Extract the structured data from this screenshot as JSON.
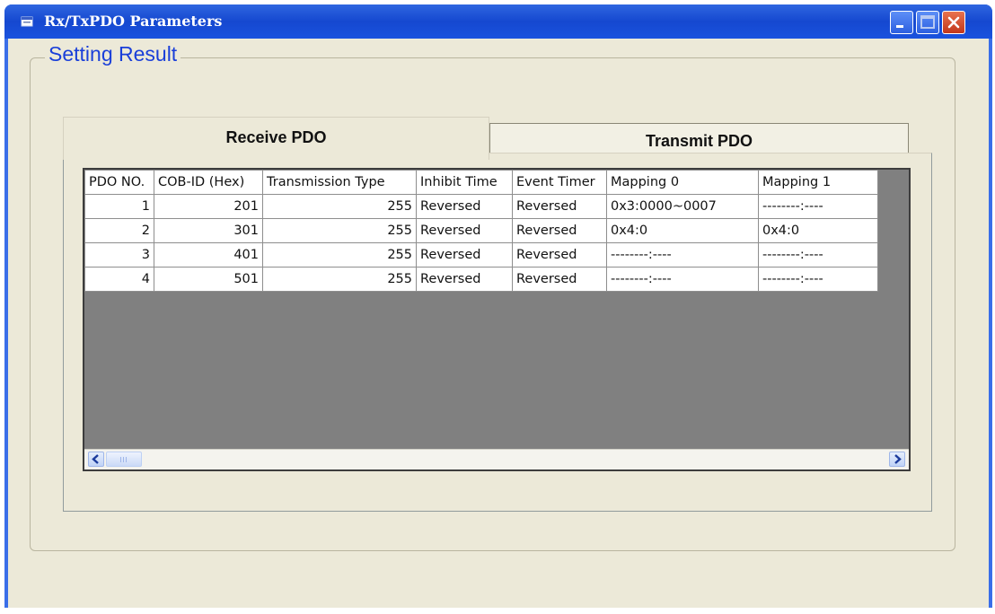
{
  "window": {
    "title": "Rx/TxPDO Parameters",
    "icons": {
      "app": "app-icon",
      "minimize": "minimize-icon",
      "maximize": "maximize-icon",
      "close": "close-icon"
    },
    "colors": {
      "titlebar": "#1548d0",
      "client": "#ece9d8",
      "group_label": "#1a3fd9"
    }
  },
  "group": {
    "label": "Setting Result"
  },
  "tabs": [
    {
      "label": "Receive PDO",
      "selected": true
    },
    {
      "label": "Transmit PDO",
      "selected": false
    }
  ],
  "table": {
    "columns": [
      "PDO NO.",
      "COB-ID (Hex)",
      "Transmission Type",
      "Inhibit Time",
      "Event Timer",
      "Mapping 0",
      "Mapping 1"
    ],
    "rows": [
      [
        "1",
        "201",
        "255",
        "Reversed",
        "Reversed",
        "0x3:0000~0007",
        "--------:----"
      ],
      [
        "2",
        "301",
        "255",
        "Reversed",
        "Reversed",
        "0x4:0",
        "0x4:0"
      ],
      [
        "3",
        "401",
        "255",
        "Reversed",
        "Reversed",
        "--------:----",
        "--------:----"
      ],
      [
        "4",
        "501",
        "255",
        "Reversed",
        "Reversed",
        "--------:----",
        "--------:----"
      ]
    ]
  },
  "scrollbar": {
    "left_icon": "chevron-left-icon",
    "right_icon": "chevron-right-icon"
  }
}
